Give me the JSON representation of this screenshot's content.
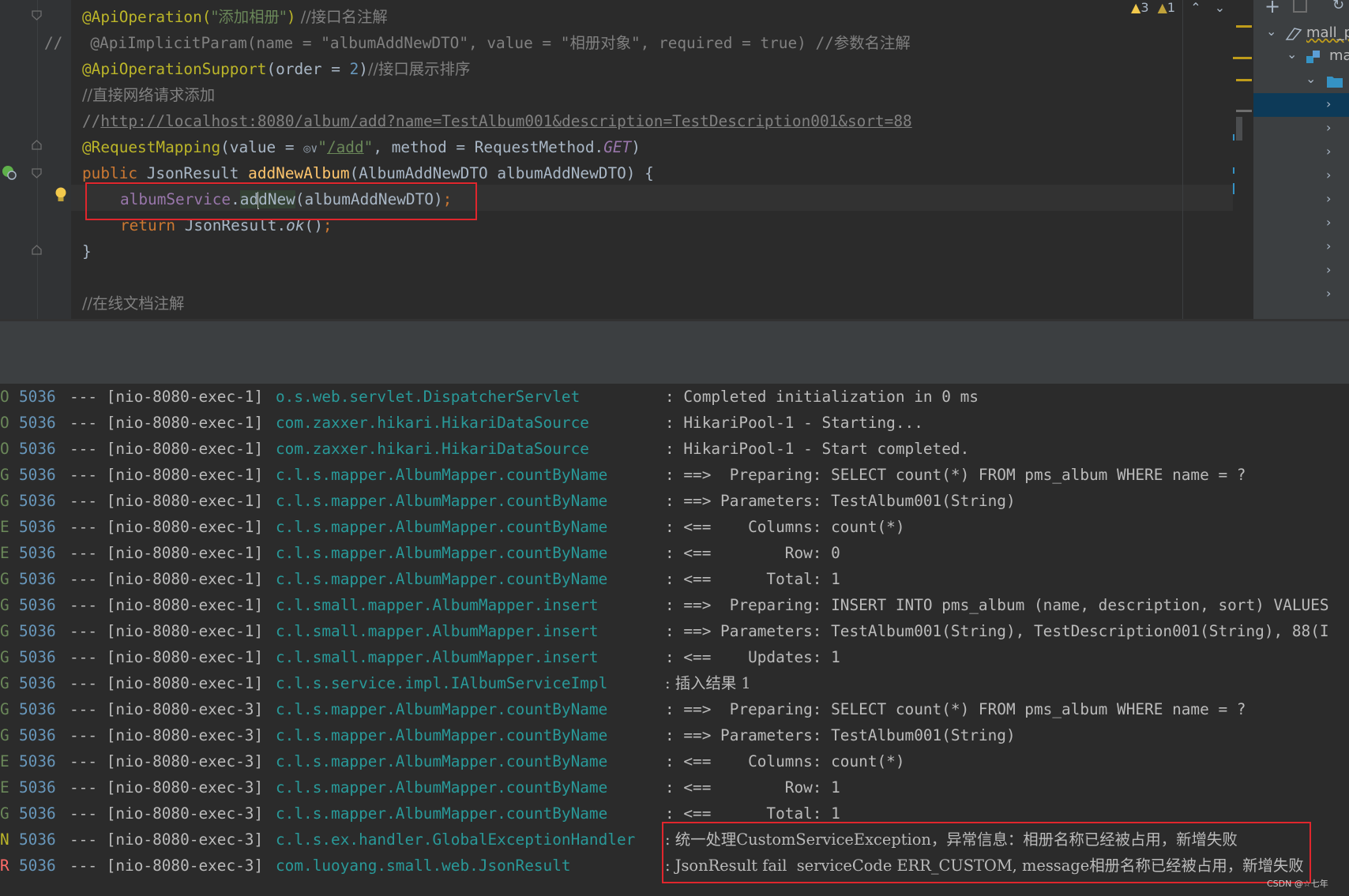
{
  "editor": {
    "lines": {
      "l1_ann": "@ApiOperation(",
      "l1_str": "\"添加相册\"",
      "l1_close": ")",
      "l1_cmt": " //接口名注解",
      "l2_prefix": "//",
      "l2_body": "   @ApiImplicitParam(name = \"albumAddNewDTO\", value = \"相册对象\", required = true) //参数名注解",
      "l3_ann": "@ApiOperationSupport",
      "l3_open": "(order = ",
      "l3_num": "2",
      "l3_close": ")",
      "l3_cmt": "//接口展示排序",
      "l4_cmt": "//直接网络请求添加",
      "l5_prefix": "//",
      "l5_link": "http://localhost:8080/album/add?name=TestAlbum001&description=TestDescription001&sort=88",
      "l6_ann": "@RequestMapping",
      "l6_open": "(value = ",
      "l6_globe": "◎∨",
      "l6_str1": "\"",
      "l6_str2": "/add",
      "l6_str3": "\"",
      "l6_mid": ", method = RequestMethod.",
      "l6_get": "GET",
      "l6_close": ")",
      "l7_kw": "public ",
      "l7_type": "JsonResult ",
      "l7_fn": "addNewAlbum",
      "l7_rest": "(AlbumAddNewDTO albumAddNewDTO) {",
      "l8_field": "albumService",
      "l8_dot": ".",
      "l8_call_a": "ad",
      "l8_call_b": "dNew",
      "l8_args": "(albumAddNewDTO)",
      "l8_semi": ";",
      "l9_kw": "return ",
      "l9_type": "JsonResult.",
      "l9_fn": "ok",
      "l9_rest": "()",
      "l9_semi": ";",
      "l10": "}",
      "l12_cmt": "//在线文档注解"
    },
    "inspections": {
      "warnings": "3",
      "weak_warnings": "1"
    }
  },
  "project_tree": {
    "items": [
      {
        "label": "mall_p"
      },
      {
        "label": "ma"
      }
    ]
  },
  "console": {
    "rows": [
      {
        "lv": "O",
        "pid": "5036",
        "thread": "--- [nio-8080-exec-1]",
        "logger": "o.s.web.servlet.DispatcherServlet",
        "msg": ": Completed initialization in 0 ms"
      },
      {
        "lv": "O",
        "pid": "5036",
        "thread": "--- [nio-8080-exec-1]",
        "logger": "com.zaxxer.hikari.HikariDataSource",
        "msg": ": HikariPool-1 - Starting..."
      },
      {
        "lv": "O",
        "pid": "5036",
        "thread": "--- [nio-8080-exec-1]",
        "logger": "com.zaxxer.hikari.HikariDataSource",
        "msg": ": HikariPool-1 - Start completed."
      },
      {
        "lv": "G",
        "pid": "5036",
        "thread": "--- [nio-8080-exec-1]",
        "logger": "c.l.s.mapper.AlbumMapper.countByName",
        "msg": ": ==>  Preparing: SELECT count(*) FROM pms_album WHERE name = ?"
      },
      {
        "lv": "G",
        "pid": "5036",
        "thread": "--- [nio-8080-exec-1]",
        "logger": "c.l.s.mapper.AlbumMapper.countByName",
        "msg": ": ==> Parameters: TestAlbum001(String)"
      },
      {
        "lv": "E",
        "pid": "5036",
        "thread": "--- [nio-8080-exec-1]",
        "logger": "c.l.s.mapper.AlbumMapper.countByName",
        "msg": ": <==    Columns: count(*)"
      },
      {
        "lv": "E",
        "pid": "5036",
        "thread": "--- [nio-8080-exec-1]",
        "logger": "c.l.s.mapper.AlbumMapper.countByName",
        "msg": ": <==        Row: 0"
      },
      {
        "lv": "G",
        "pid": "5036",
        "thread": "--- [nio-8080-exec-1]",
        "logger": "c.l.s.mapper.AlbumMapper.countByName",
        "msg": ": <==      Total: 1"
      },
      {
        "lv": "G",
        "pid": "5036",
        "thread": "--- [nio-8080-exec-1]",
        "logger": "c.l.small.mapper.AlbumMapper.insert",
        "msg": ": ==>  Preparing: INSERT INTO pms_album (name, description, sort) VALUES"
      },
      {
        "lv": "G",
        "pid": "5036",
        "thread": "--- [nio-8080-exec-1]",
        "logger": "c.l.small.mapper.AlbumMapper.insert",
        "msg": ": ==> Parameters: TestAlbum001(String), TestDescription001(String), 88(I"
      },
      {
        "lv": "G",
        "pid": "5036",
        "thread": "--- [nio-8080-exec-1]",
        "logger": "c.l.small.mapper.AlbumMapper.insert",
        "msg": ": <==    Updates: 1"
      },
      {
        "lv": "G",
        "pid": "5036",
        "thread": "--- [nio-8080-exec-1]",
        "logger": "c.l.s.service.impl.IAlbumServiceImpl",
        "msg": ": 插入结果 1"
      },
      {
        "lv": "G",
        "pid": "5036",
        "thread": "--- [nio-8080-exec-3]",
        "logger": "c.l.s.mapper.AlbumMapper.countByName",
        "msg": ": ==>  Preparing: SELECT count(*) FROM pms_album WHERE name = ?"
      },
      {
        "lv": "G",
        "pid": "5036",
        "thread": "--- [nio-8080-exec-3]",
        "logger": "c.l.s.mapper.AlbumMapper.countByName",
        "msg": ": ==> Parameters: TestAlbum001(String)"
      },
      {
        "lv": "E",
        "pid": "5036",
        "thread": "--- [nio-8080-exec-3]",
        "logger": "c.l.s.mapper.AlbumMapper.countByName",
        "msg": ": <==    Columns: count(*)"
      },
      {
        "lv": "E",
        "pid": "5036",
        "thread": "--- [nio-8080-exec-3]",
        "logger": "c.l.s.mapper.AlbumMapper.countByName",
        "msg": ": <==        Row: 1"
      },
      {
        "lv": "G",
        "pid": "5036",
        "thread": "--- [nio-8080-exec-3]",
        "logger": "c.l.s.mapper.AlbumMapper.countByName",
        "msg": ": <==      Total: 1"
      },
      {
        "lv": "N",
        "pid": "5036",
        "thread": "--- [nio-8080-exec-3]",
        "logger": "c.l.s.ex.handler.GlobalExceptionHandler",
        "msg": ": 统一处理CustomServiceException，异常信息：相册名称已经被占用，新增失败"
      },
      {
        "lv": "R",
        "pid": "5036",
        "thread": "--- [nio-8080-exec-3]",
        "logger": "com.luoyang.small.web.JsonResult",
        "msg": ": JsonResult fail  serviceCode ERR_CUSTOM, message相册名称已经被占用，新增失败"
      }
    ]
  },
  "watermark": "CSDN @☆七年"
}
